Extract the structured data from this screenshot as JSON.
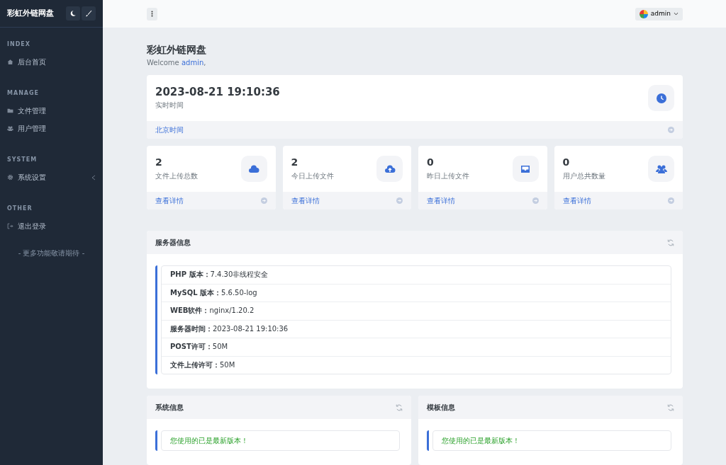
{
  "sidebar": {
    "brand": "彩虹外链网盘",
    "sections": [
      {
        "heading": "INDEX",
        "items": [
          {
            "label": "后台首页",
            "expandable": false
          }
        ]
      },
      {
        "heading": "MANAGE",
        "items": [
          {
            "label": "文件管理",
            "expandable": false
          },
          {
            "label": "用户管理",
            "expandable": false
          }
        ]
      },
      {
        "heading": "SYSTEM",
        "items": [
          {
            "label": "系统设置",
            "expandable": true
          }
        ]
      },
      {
        "heading": "OTHER",
        "items": [
          {
            "label": "退出登录",
            "expandable": false
          }
        ]
      }
    ],
    "footer": "- 更多功能敬请期待 -"
  },
  "header": {
    "user": "admin"
  },
  "page": {
    "title": "彩虹外链网盘",
    "welcome": "Welcome",
    "user": "admin",
    "comma": ","
  },
  "clock": {
    "value": "2023-08-21 19:10:36",
    "label": "实时时间",
    "link": "北京时间"
  },
  "stats": [
    {
      "value": "2",
      "label": "文件上传总数",
      "link": "查看详情"
    },
    {
      "value": "2",
      "label": "今日上传文件",
      "link": "查看详情"
    },
    {
      "value": "0",
      "label": "昨日上传文件",
      "link": "查看详情"
    },
    {
      "value": "0",
      "label": "用户总共数量",
      "link": "查看详情"
    }
  ],
  "server": {
    "title": "服务器信息",
    "rows": [
      {
        "key": "PHP 版本：",
        "value": "7.4.30非线程安全"
      },
      {
        "key": "MySQL 版本：",
        "value": "5.6.50-log"
      },
      {
        "key": "WEB软件：",
        "value": "nginx/1.20.2"
      },
      {
        "key": "服务器时间：",
        "value": "2023-08-21 19:10:36"
      },
      {
        "key": "POST许可：",
        "value": "50M"
      },
      {
        "key": "文件上传许可：",
        "value": "50M"
      }
    ]
  },
  "panels": [
    {
      "title": "系统信息",
      "message": "您使用的已是最新版本！"
    },
    {
      "title": "模板信息",
      "message": "您使用的已是最新版本！"
    }
  ]
}
